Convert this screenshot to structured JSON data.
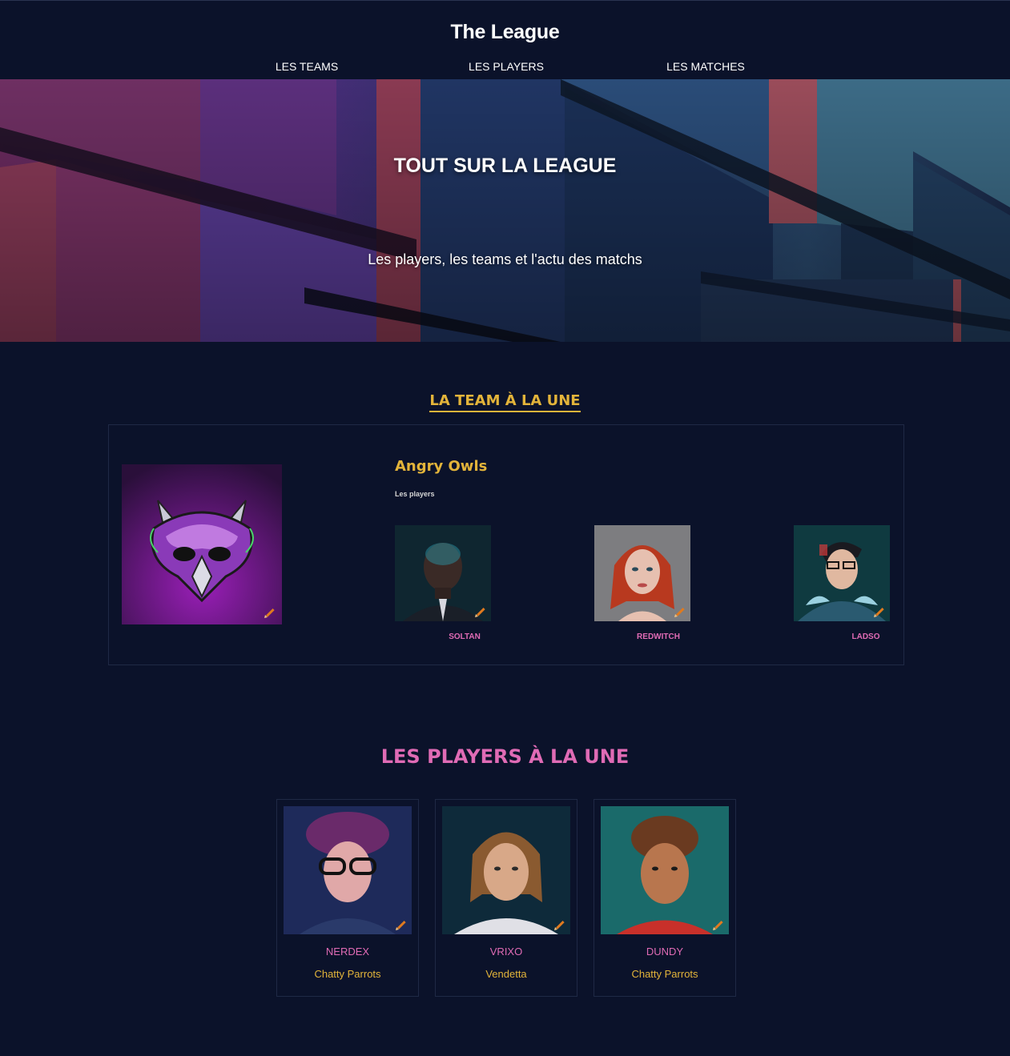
{
  "header": {
    "title": "The League",
    "nav": [
      {
        "label": "LES TEAMS"
      },
      {
        "label": "LES PLAYERS"
      },
      {
        "label": "LES MATCHES"
      }
    ]
  },
  "hero": {
    "title": "TOUT SUR LA LEAGUE",
    "subtitle": "Les players, les teams et l'actu des matchs"
  },
  "featured_team": {
    "section_title": "LA TEAM À LA UNE",
    "name": "Angry Owls",
    "players_label": "Les players",
    "players": [
      {
        "name": "SOLTAN"
      },
      {
        "name": "REDWITCH"
      },
      {
        "name": "LADSO"
      }
    ]
  },
  "featured_players": {
    "section_title": "LES PLAYERS À LA UNE",
    "players": [
      {
        "name": "NERDEX",
        "team": "Chatty Parrots"
      },
      {
        "name": "VRIXO",
        "team": "Vendetta"
      },
      {
        "name": "DUNDY",
        "team": "Chatty Parrots"
      }
    ]
  },
  "colors": {
    "background": "#0b122a",
    "gold": "#e3b43a",
    "pink": "#e06bb5"
  }
}
